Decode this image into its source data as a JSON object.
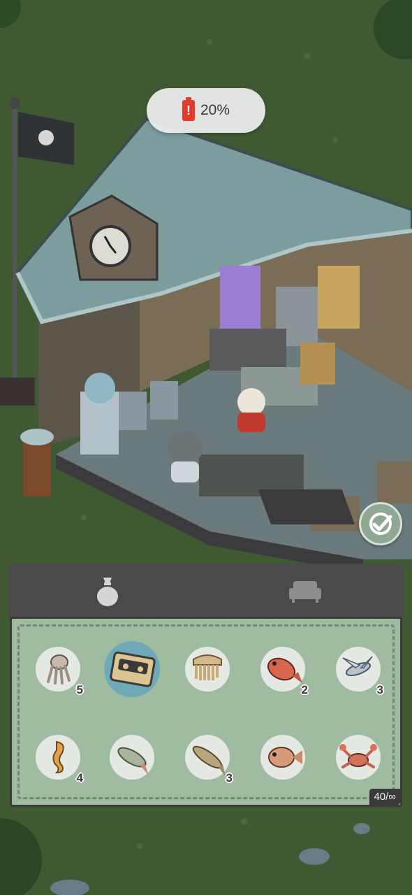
{
  "hud": {
    "battery": {
      "percent_text": "20%",
      "level": 0.2,
      "color": "#e23b2e",
      "icon": "battery-low-icon"
    }
  },
  "confirm": {
    "icon": "checkmark-icon"
  },
  "inventory": {
    "tabs": [
      {
        "icon": "bag-icon",
        "active": true
      },
      {
        "icon": "sofa-icon",
        "active": false
      }
    ],
    "capacity_text": "40/∞",
    "items": [
      {
        "icon": "squid-icon",
        "count": "5"
      },
      {
        "icon": "cassette-tape-icon",
        "count": "",
        "selected": true
      },
      {
        "icon": "comb-icon",
        "count": ""
      },
      {
        "icon": "red-snapper-icon",
        "count": "2"
      },
      {
        "icon": "flying-fish-icon",
        "count": "3"
      },
      {
        "icon": "seahorse-icon",
        "count": "4"
      },
      {
        "icon": "trout-icon",
        "count": ""
      },
      {
        "icon": "pike-fish-icon",
        "count": "3"
      },
      {
        "icon": "piranha-icon",
        "count": ""
      },
      {
        "icon": "crab-icon",
        "count": ""
      }
    ]
  },
  "colors": {
    "grass": "#3f5a33",
    "roof": "#7c9c9e",
    "panel": "#9fbca0",
    "tab_bar": "#4a4a4a"
  }
}
